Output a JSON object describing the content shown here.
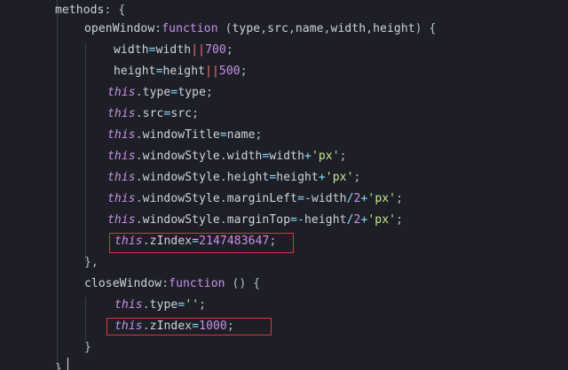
{
  "editor": {
    "lines": [
      {
        "id": "methods",
        "tokens": [
          {
            "t": "methods",
            "c": "prop"
          },
          {
            "t": ": {",
            "c": "punc"
          }
        ]
      },
      {
        "id": "open-window-decl",
        "tokens": [
          {
            "t": "openWindow",
            "c": "prop"
          },
          {
            "t": ":",
            "c": "punc"
          },
          {
            "t": "function",
            "c": "kw"
          },
          {
            "t": " (",
            "c": "punc"
          },
          {
            "t": "type",
            "c": "param"
          },
          {
            "t": ",",
            "c": "punc"
          },
          {
            "t": "src",
            "c": "param"
          },
          {
            "t": ",",
            "c": "punc"
          },
          {
            "t": "name",
            "c": "param"
          },
          {
            "t": ",",
            "c": "punc"
          },
          {
            "t": "width",
            "c": "param"
          },
          {
            "t": ",",
            "c": "punc"
          },
          {
            "t": "height",
            "c": "param"
          },
          {
            "t": ") {",
            "c": "punc"
          }
        ]
      },
      {
        "id": "width-default",
        "tokens": [
          {
            "t": "width",
            "c": "param"
          },
          {
            "t": "=",
            "c": "op"
          },
          {
            "t": "width",
            "c": "param"
          },
          {
            "t": "||",
            "c": "bar"
          },
          {
            "t": "700",
            "c": "num"
          },
          {
            "t": ";",
            "c": "punc"
          }
        ]
      },
      {
        "id": "height-default",
        "tokens": [
          {
            "t": "height",
            "c": "param"
          },
          {
            "t": "=",
            "c": "op"
          },
          {
            "t": "height",
            "c": "param"
          },
          {
            "t": "||",
            "c": "bar"
          },
          {
            "t": "500",
            "c": "num"
          },
          {
            "t": ";",
            "c": "punc"
          }
        ]
      },
      {
        "id": "this-type",
        "tokens": [
          {
            "t": "this",
            "c": "this"
          },
          {
            "t": ".",
            "c": "punc"
          },
          {
            "t": "type",
            "c": "prop"
          },
          {
            "t": "=",
            "c": "op"
          },
          {
            "t": "type",
            "c": "param"
          },
          {
            "t": ";",
            "c": "punc"
          }
        ]
      },
      {
        "id": "this-src",
        "tokens": [
          {
            "t": "this",
            "c": "this"
          },
          {
            "t": ".",
            "c": "punc"
          },
          {
            "t": "src",
            "c": "prop"
          },
          {
            "t": "=",
            "c": "op"
          },
          {
            "t": "src",
            "c": "param"
          },
          {
            "t": ";",
            "c": "punc"
          }
        ]
      },
      {
        "id": "this-window-title",
        "tokens": [
          {
            "t": "this",
            "c": "this"
          },
          {
            "t": ".",
            "c": "punc"
          },
          {
            "t": "windowTitle",
            "c": "prop"
          },
          {
            "t": "=",
            "c": "op"
          },
          {
            "t": "name",
            "c": "param"
          },
          {
            "t": ";",
            "c": "punc"
          }
        ]
      },
      {
        "id": "this-style-width",
        "tokens": [
          {
            "t": "this",
            "c": "this"
          },
          {
            "t": ".",
            "c": "punc"
          },
          {
            "t": "windowStyle",
            "c": "prop"
          },
          {
            "t": ".",
            "c": "punc"
          },
          {
            "t": "width",
            "c": "prop"
          },
          {
            "t": "=",
            "c": "op"
          },
          {
            "t": "width",
            "c": "param"
          },
          {
            "t": "+",
            "c": "op"
          },
          {
            "t": "'px'",
            "c": "str"
          },
          {
            "t": ";",
            "c": "punc"
          }
        ]
      },
      {
        "id": "this-style-height",
        "tokens": [
          {
            "t": "this",
            "c": "this"
          },
          {
            "t": ".",
            "c": "punc"
          },
          {
            "t": "windowStyle",
            "c": "prop"
          },
          {
            "t": ".",
            "c": "punc"
          },
          {
            "t": "height",
            "c": "prop"
          },
          {
            "t": "=",
            "c": "op"
          },
          {
            "t": "height",
            "c": "param"
          },
          {
            "t": "+",
            "c": "op"
          },
          {
            "t": "'px'",
            "c": "str"
          },
          {
            "t": ";",
            "c": "punc"
          }
        ]
      },
      {
        "id": "this-style-margin-left",
        "tokens": [
          {
            "t": "this",
            "c": "this"
          },
          {
            "t": ".",
            "c": "punc"
          },
          {
            "t": "windowStyle",
            "c": "prop"
          },
          {
            "t": ".",
            "c": "punc"
          },
          {
            "t": "marginLeft",
            "c": "prop"
          },
          {
            "t": "=-",
            "c": "op"
          },
          {
            "t": "width",
            "c": "param"
          },
          {
            "t": "/",
            "c": "op"
          },
          {
            "t": "2",
            "c": "num"
          },
          {
            "t": "+",
            "c": "op"
          },
          {
            "t": "'px'",
            "c": "str"
          },
          {
            "t": ";",
            "c": "punc"
          }
        ]
      },
      {
        "id": "this-style-margin-top",
        "tokens": [
          {
            "t": "this",
            "c": "this"
          },
          {
            "t": ".",
            "c": "punc"
          },
          {
            "t": "windowStyle",
            "c": "prop"
          },
          {
            "t": ".",
            "c": "punc"
          },
          {
            "t": "marginTop",
            "c": "prop"
          },
          {
            "t": "=-",
            "c": "op"
          },
          {
            "t": "height",
            "c": "param"
          },
          {
            "t": "/",
            "c": "op"
          },
          {
            "t": "2",
            "c": "num"
          },
          {
            "t": "+",
            "c": "op"
          },
          {
            "t": "'px'",
            "c": "str"
          },
          {
            "t": ";",
            "c": "punc"
          }
        ]
      },
      {
        "id": "this-zindex-max",
        "tokens": [
          {
            "t": "this",
            "c": "this"
          },
          {
            "t": ".",
            "c": "punc"
          },
          {
            "t": "zIndex",
            "c": "prop"
          },
          {
            "t": "=",
            "c": "op"
          },
          {
            "t": "2147483647",
            "c": "num"
          },
          {
            "t": ";",
            "c": "punc"
          }
        ]
      },
      {
        "id": "open-window-close",
        "tokens": [
          {
            "t": "},",
            "c": "punc"
          }
        ]
      },
      {
        "id": "close-window-decl",
        "tokens": [
          {
            "t": "closeWindow",
            "c": "prop"
          },
          {
            "t": ":",
            "c": "punc"
          },
          {
            "t": "function",
            "c": "kw"
          },
          {
            "t": " () {",
            "c": "punc"
          }
        ]
      },
      {
        "id": "this-type-reset",
        "tokens": [
          {
            "t": "this",
            "c": "this"
          },
          {
            "t": ".",
            "c": "punc"
          },
          {
            "t": "type",
            "c": "prop"
          },
          {
            "t": "=",
            "c": "op"
          },
          {
            "t": "''",
            "c": "str"
          },
          {
            "t": ";",
            "c": "punc"
          }
        ]
      },
      {
        "id": "this-zindex-reset",
        "tokens": [
          {
            "t": "this",
            "c": "this"
          },
          {
            "t": ".",
            "c": "punc"
          },
          {
            "t": "zIndex",
            "c": "prop"
          },
          {
            "t": "=",
            "c": "op"
          },
          {
            "t": "1000",
            "c": "num"
          },
          {
            "t": ";",
            "c": "punc"
          }
        ]
      },
      {
        "id": "close-window-close",
        "tokens": [
          {
            "t": "}",
            "c": "punc"
          }
        ]
      },
      {
        "id": "methods-close",
        "tokens": [
          {
            "t": "}",
            "c": "punc"
          }
        ]
      }
    ],
    "colors": {
      "background": "#1e1f26",
      "keyword": "#c792ea",
      "operator": "#89ddff",
      "string": "#c3e88d",
      "number": "#c792ea",
      "highlight_box": "#d9333f"
    }
  }
}
